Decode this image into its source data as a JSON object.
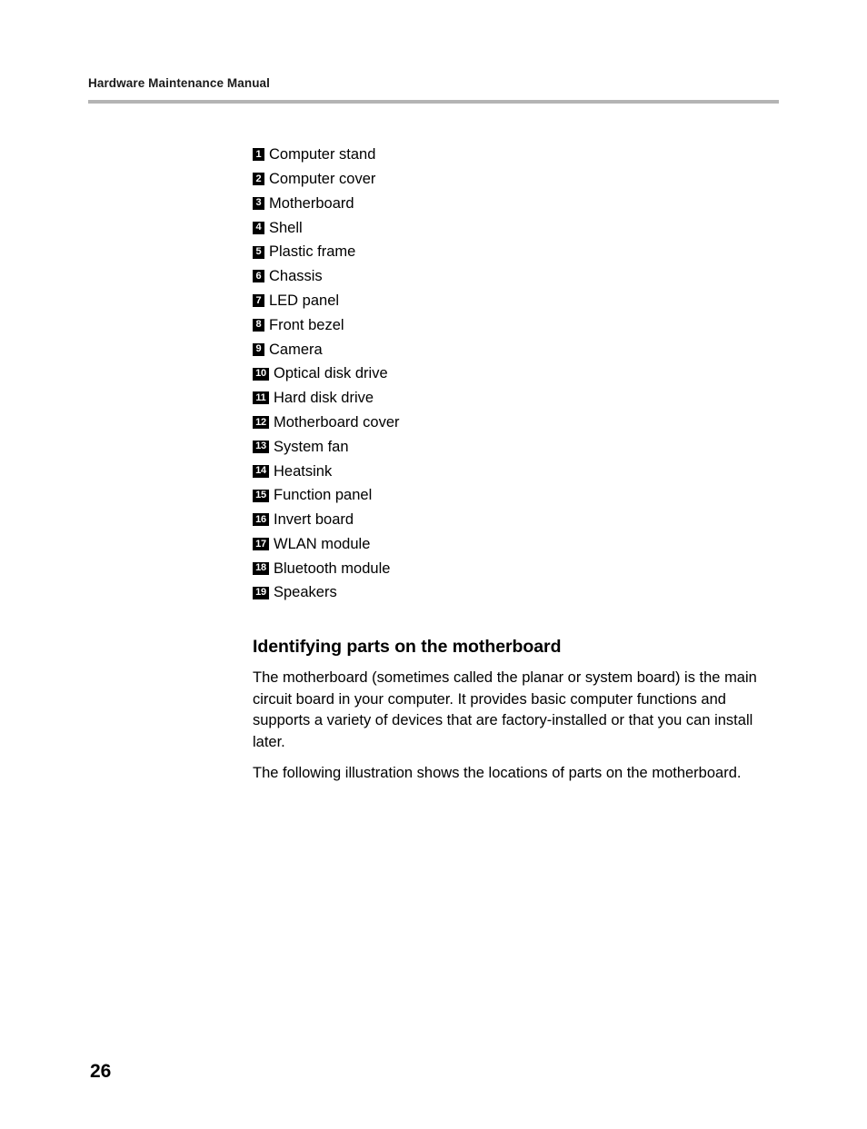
{
  "header": {
    "title": "Hardware Maintenance Manual"
  },
  "parts_list": {
    "items": [
      {
        "number": "1",
        "label": "Computer stand"
      },
      {
        "number": "2",
        "label": "Computer cover"
      },
      {
        "number": "3",
        "label": "Motherboard"
      },
      {
        "number": "4",
        "label": "Shell"
      },
      {
        "number": "5",
        "label": "Plastic frame"
      },
      {
        "number": "6",
        "label": "Chassis"
      },
      {
        "number": "7",
        "label": "LED panel"
      },
      {
        "number": "8",
        "label": "Front bezel"
      },
      {
        "number": "9",
        "label": "Camera"
      },
      {
        "number": "10",
        "label": "Optical disk drive"
      },
      {
        "number": "11",
        "label": "Hard disk drive"
      },
      {
        "number": "12",
        "label": "Motherboard cover"
      },
      {
        "number": "13",
        "label": "System fan"
      },
      {
        "number": "14",
        "label": "Heatsink"
      },
      {
        "number": "15",
        "label": "Function panel"
      },
      {
        "number": "16",
        "label": "Invert board"
      },
      {
        "number": "17",
        "label": "WLAN module"
      },
      {
        "number": "18",
        "label": "Bluetooth module"
      },
      {
        "number": "19",
        "label": "Speakers"
      }
    ]
  },
  "section": {
    "heading": "Identifying parts on the motherboard",
    "paragraph_1": "The motherboard (sometimes called the planar or system board) is the main circuit board in your computer. It provides basic computer functions and supports a variety of devices that are factory-installed or that you can install later.",
    "paragraph_2": "The following illustration shows the locations of parts on the motherboard."
  },
  "footer": {
    "page_number": "26"
  },
  "colors": {
    "text": "#000000",
    "header_rule": "#b4b4b4",
    "badge_background": "#000000",
    "badge_text": "#ffffff"
  }
}
